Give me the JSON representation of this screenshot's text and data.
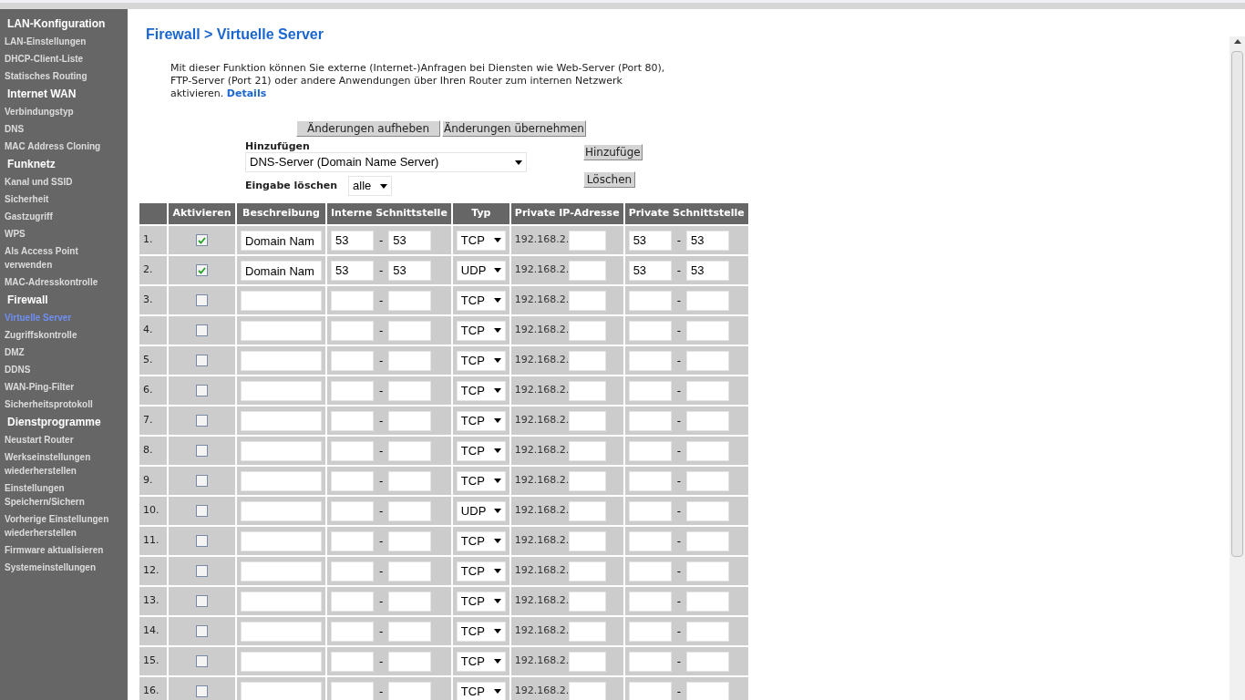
{
  "sidebar": {
    "sections": [
      {
        "title": "LAN-Konfiguration",
        "items": [
          {
            "label": "LAN-Einstellungen",
            "selected": false
          },
          {
            "label": "DHCP-Client-Liste",
            "selected": false
          },
          {
            "label": "Statisches Routing",
            "selected": false
          }
        ]
      },
      {
        "title": "Internet WAN",
        "items": [
          {
            "label": "Verbindungstyp",
            "selected": false
          },
          {
            "label": "DNS",
            "selected": false
          },
          {
            "label": "MAC Address Cloning",
            "selected": false
          }
        ]
      },
      {
        "title": "Funknetz",
        "items": [
          {
            "label": "Kanal und SSID",
            "selected": false
          },
          {
            "label": "Sicherheit",
            "selected": false
          },
          {
            "label": "Gastzugriff",
            "selected": false
          },
          {
            "label": "WPS",
            "selected": false
          },
          {
            "label": "Als Access Point verwenden",
            "selected": false
          },
          {
            "label": "MAC-Adresskontrolle",
            "selected": false
          }
        ]
      },
      {
        "title": "Firewall",
        "items": [
          {
            "label": "Virtuelle Server",
            "selected": true
          },
          {
            "label": "Zugriffskontrolle",
            "selected": false
          },
          {
            "label": "DMZ",
            "selected": false
          },
          {
            "label": "DDNS",
            "selected": false
          },
          {
            "label": "WAN-Ping-Filter",
            "selected": false
          },
          {
            "label": "Sicherheitsprotokoll",
            "selected": false
          }
        ]
      },
      {
        "title": "Dienstprogramme",
        "items": [
          {
            "label": "Neustart Router",
            "selected": false
          },
          {
            "label": "Werkseinstellungen wiederherstellen",
            "selected": false
          },
          {
            "label": "Einstellungen Speichern/Sichern",
            "selected": false
          },
          {
            "label": "Vorherige Einstellungen wiederherstellen",
            "selected": false
          },
          {
            "label": "Firmware aktualisieren",
            "selected": false
          },
          {
            "label": "Systemeinstellungen",
            "selected": false
          }
        ]
      }
    ]
  },
  "page": {
    "title": "Firewall > Virtuelle Server",
    "intro": "Mit dieser Funktion können Sie externe (Internet-)Anfragen bei Diensten wie Web-Server (Port 80), FTP-Server (Port 21) oder andere Anwendungen über Ihren Router zum internen Netzwerk aktivieren.",
    "details_link": "Details"
  },
  "actions": {
    "discard": "Änderungen aufheben",
    "apply": "Änderungen übernehmen"
  },
  "add": {
    "label": "Hinzufügen",
    "value": "DNS-Server (Domain Name Server)",
    "button": "Hinzufüge"
  },
  "clear": {
    "label": "Eingabe löschen",
    "value": "alle",
    "button": "Löschen"
  },
  "table": {
    "columns": [
      "Aktivieren",
      "Beschreibung",
      "Interne Schnittstelle",
      "Typ",
      "Private IP-Adresse",
      "Private Schnittstelle"
    ],
    "separator": "-",
    "rows": [
      {
        "number": "1.",
        "checked": true,
        "description": "Domain Nam",
        "internal_from": "53",
        "internal_to": "53",
        "type": "TCP",
        "ip_prefix": "192.168.2.",
        "private_from": "53",
        "private_to": "53"
      },
      {
        "number": "2.",
        "checked": true,
        "description": "Domain Nam",
        "internal_from": "53",
        "internal_to": "53",
        "type": "UDP",
        "ip_prefix": "192.168.2.",
        "private_from": "53",
        "private_to": "53"
      },
      {
        "number": "3.",
        "checked": false,
        "type": "TCP",
        "ip_prefix": "192.168.2."
      },
      {
        "number": "4.",
        "checked": false,
        "type": "TCP",
        "ip_prefix": "192.168.2."
      },
      {
        "number": "5.",
        "checked": false,
        "type": "TCP",
        "ip_prefix": "192.168.2."
      },
      {
        "number": "6.",
        "checked": false,
        "type": "TCP",
        "ip_prefix": "192.168.2."
      },
      {
        "number": "7.",
        "checked": false,
        "type": "TCP",
        "ip_prefix": "192.168.2."
      },
      {
        "number": "8.",
        "checked": false,
        "type": "TCP",
        "ip_prefix": "192.168.2."
      },
      {
        "number": "9.",
        "checked": false,
        "type": "TCP",
        "ip_prefix": "192.168.2."
      },
      {
        "number": "10.",
        "checked": false,
        "type": "UDP",
        "ip_prefix": "192.168.2."
      },
      {
        "number": "11.",
        "checked": false,
        "type": "TCP",
        "ip_prefix": "192.168.2."
      },
      {
        "number": "12.",
        "checked": false,
        "type": "TCP",
        "ip_prefix": "192.168.2."
      },
      {
        "number": "13.",
        "checked": false,
        "type": "TCP",
        "ip_prefix": "192.168.2."
      },
      {
        "number": "14.",
        "checked": false,
        "type": "TCP",
        "ip_prefix": "192.168.2."
      },
      {
        "number": "15.",
        "checked": false,
        "type": "TCP",
        "ip_prefix": "192.168.2."
      },
      {
        "number": "16.",
        "checked": false,
        "type": "TCP",
        "ip_prefix": "192.168.2."
      }
    ]
  }
}
